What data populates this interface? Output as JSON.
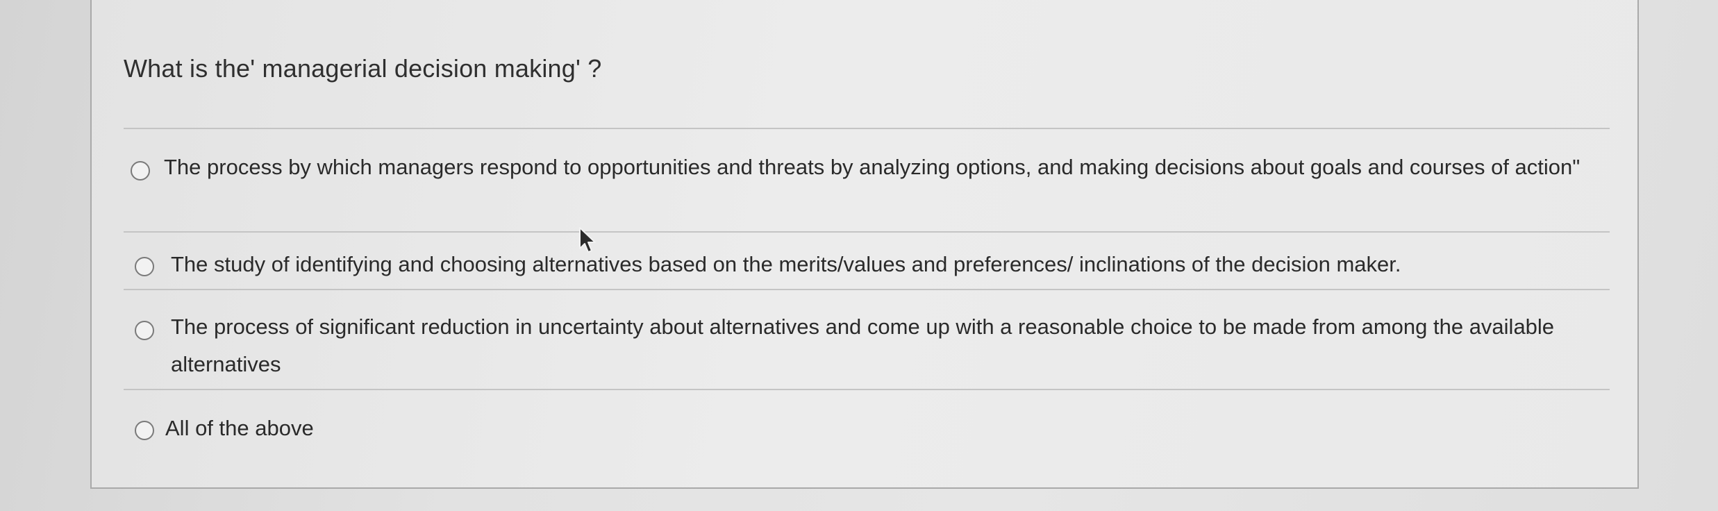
{
  "question": {
    "text": "What is the' managerial decision making' ?"
  },
  "options": [
    {
      "label": "The process by which managers respond to opportunities and threats by analyzing options, and making decisions about goals and courses of action\"",
      "selected": false
    },
    {
      "label": "The study of identifying and choosing alternatives based on the merits/values and preferences/ inclinations of the decision maker.",
      "selected": false
    },
    {
      "label": "The process of significant reduction in uncertainty about alternatives and come up with a reasonable choice to be made from among the available alternatives",
      "selected": false
    },
    {
      "label": "All of the above",
      "selected": false
    }
  ],
  "icons": {
    "cursor": "mouse-pointer-icon",
    "radio": "radio-button-icon"
  },
  "colors": {
    "card_background": "#ececec",
    "card_border": "#a9a9a9",
    "text": "#2a2a2a",
    "divider": "#c4c4c4"
  }
}
